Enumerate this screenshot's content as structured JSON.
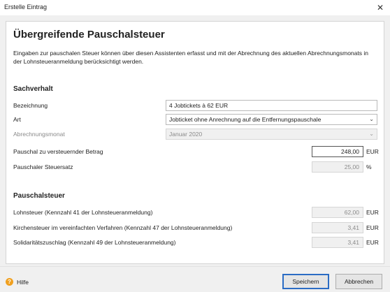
{
  "window": {
    "title": "Erstelle Eintrag",
    "close_glyph": "✕"
  },
  "heading": "Übergreifende Pauschalsteuer",
  "description": "Eingaben zur pauschalen Steuer können über diesen Assistenten erfasst und mit der Abrechnung des aktuellen Abrechnungsmonats in der Lohnsteueranmeldung berücksichtigt werden.",
  "sachverhalt": {
    "section_title": "Sachverhalt",
    "bezeichnung": {
      "label": "Bezeichnung",
      "value": "4 Jobtickets à 62 EUR"
    },
    "art": {
      "label": "Art",
      "value": "Jobticket ohne Anrechnung auf die Entfernungspauschale"
    },
    "abrechnungsmonat": {
      "label": "Abrechnungsmonat",
      "value": "Januar 2020"
    },
    "betrag": {
      "label": "Pauschal zu versteuernder Betrag",
      "value": "248,00",
      "unit": "EUR"
    },
    "steuersatz": {
      "label": "Pauschaler Steuersatz",
      "value": "25,00",
      "unit": "%"
    }
  },
  "pauschalsteuer": {
    "section_title": "Pauschalsteuer",
    "lohnsteuer": {
      "label": "Lohnsteuer (Kennzahl 41 der Lohnsteueranmeldung)",
      "value": "62,00",
      "unit": "EUR"
    },
    "kirchensteuer": {
      "label": "Kirchensteuer im vereinfachten Verfahren (Kennzahl 47 der Lohnsteueranmeldung)",
      "value": "3,41",
      "unit": "EUR"
    },
    "soli": {
      "label": "Solidaritätszuschlag (Kennzahl 49 der Lohnsteueranmeldung)",
      "value": "3,41",
      "unit": "EUR"
    }
  },
  "footer": {
    "help_label": "Hilfe",
    "help_icon": "?",
    "save_label": "Speichern",
    "cancel_label": "Abbrechen"
  },
  "icons": {
    "dropdown": "chevron-down-icon",
    "help": "help-icon",
    "close": "close-icon"
  },
  "colors": {
    "help_icon": "#f0a020",
    "default_button_border": "#2b6cc4"
  }
}
